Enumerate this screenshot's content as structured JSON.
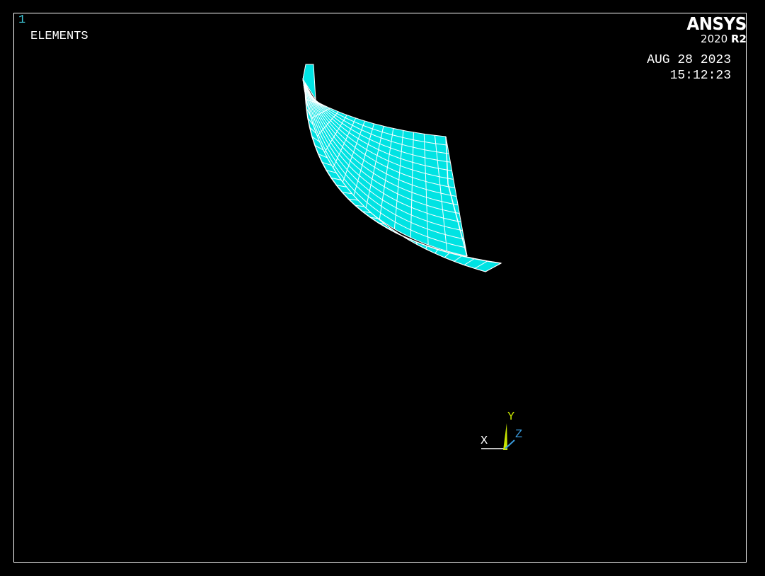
{
  "viewport": {
    "window_number": "1",
    "plot_label": "ELEMENTS",
    "date": "AUG 28 2023",
    "time": "15:12:23"
  },
  "logo": {
    "brand": "ANSYS",
    "version_year": "2020",
    "version_release": "R2"
  },
  "triad": {
    "x_label": "X",
    "y_label": "Y",
    "z_label": "Z",
    "x_color": "#ffffff",
    "y_color": "#c8e600",
    "z_color": "#3a9bdc"
  },
  "colors": {
    "background": "#000000",
    "frame": "#ffffff",
    "element_fill": "#00e3e3",
    "element_edge": "#ffffff",
    "window_number": "#3ec6d6"
  }
}
